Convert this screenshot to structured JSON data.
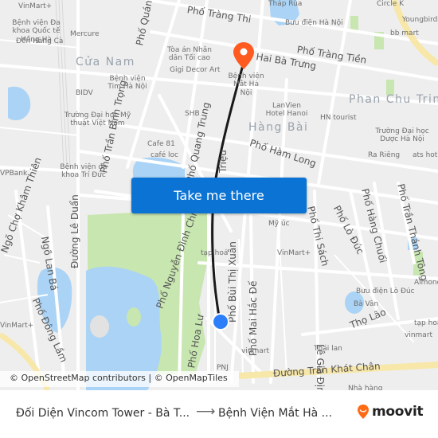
{
  "map": {
    "attribution": "© OpenStreetMap contributors | © OpenMapTiles",
    "cta_label": "Take me there",
    "colors": {
      "background": "#eeeeee",
      "road": "#ffffff",
      "water": "#aad3f5",
      "park": "#c8e6b0",
      "major_road": "#f7e7a8",
      "route_line": "#1a1a1a",
      "destination_pin": "#ff5a1f",
      "origin_dot": "#2d7ff9",
      "cta_button": "#0a73d4",
      "brand_orange": "#ff6a13"
    },
    "districts": [
      "Cửa Nam",
      "Hàng Bài",
      "Phan Chu Trinh"
    ],
    "streets": [
      "Phố Tràng Thi",
      "Phố Tràng Tiền",
      "Phố Hai Bà Trưng",
      "Phố Quán Sứ",
      "Phố Trần Bình Trọng",
      "Phố Quang Trung",
      "Phố Hàm Long",
      "Triệu",
      "Phố Thi Sách",
      "Phố Lò Đúc",
      "Phố Hàng Chuối",
      "Phố Trần Thánh Tông",
      "Phố Nguyễn Đình Chiểu",
      "Phố Bùi Thị Xuân",
      "Phố Mai Hắc Đế",
      "Phố Hoa Lư",
      "Lê Gia Định",
      "Thọ Lão",
      "Đường Trần Khát Chân",
      "Đường Lê Duẩn",
      "Ngõ Lan Bá",
      "Phố Đông Lầm",
      "Ngõ Chợ Khâm Thiên"
    ],
    "pois": [
      "VinMart+",
      "Bệnh viện Đa khoa Quốc tế Hồng Hà",
      "Đền Hàng Cà",
      "Mercure",
      "BIDV",
      "Bệnh viện Tim Hà Nội",
      "Tòa án Nhân dân Tối cao",
      "Gigi Decor Art",
      "Bệnh viện Mắt Hà Nội",
      "Bưu điện Hà Nội",
      "Tháp Rùa",
      "Circle K",
      "Youngbirds",
      "bb mart",
      "Trường Đại học Mỹ thuật Việt Nam",
      "SHB",
      "LanVien Hotel Hanoi",
      "HN tourist",
      "Trường Đại học Dược Hà Nội",
      "Cafe 81",
      "café loc",
      "Ra Riêng",
      "ats hotel",
      "Bệnh viện đa khoa Trí Đức",
      "VPBank",
      "Mỹ úc",
      "tạp hoá",
      "VinMart+",
      "Almond",
      "Bưu điện Lò Đúc",
      "Bà Vân",
      "tạp hoá",
      "vinmart",
      "vinmart",
      "Thái lan",
      "PNJ",
      "Nhà hàng",
      "VinMart+"
    ]
  },
  "footer": {
    "origin": "Đối Diện Vincom Tower - Bà T...",
    "arrow": "⟶",
    "destination": "Bệnh Viện Mắt Hà ...",
    "brand": "moovit"
  }
}
